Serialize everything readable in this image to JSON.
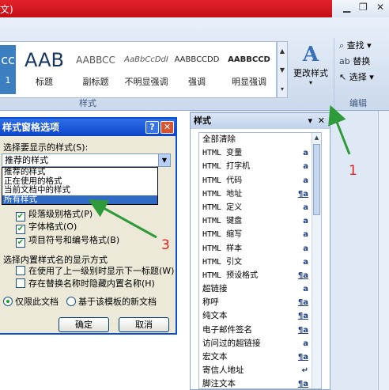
{
  "window": {
    "title_fragment": "文)"
  },
  "gallery": {
    "items": [
      {
        "preview": "cc",
        "name": "1"
      },
      {
        "preview": "AAB",
        "name": "标题"
      },
      {
        "preview": "AABBCC",
        "name": "副标题"
      },
      {
        "preview": "AaBbCcDdI",
        "name": "不明显强调"
      },
      {
        "preview": "AABBCCDD",
        "name": "强调"
      },
      {
        "preview": "AABBCCD",
        "name": "明显强调"
      }
    ]
  },
  "change_styles": {
    "label": "更改样式"
  },
  "group_labels": {
    "styles": "样式",
    "editing": "编辑"
  },
  "editing": {
    "find": "查找",
    "replace": "替换",
    "select": "选择"
  },
  "styles_pane": {
    "title": "样式",
    "items": [
      {
        "name": "全部清除",
        "icon": ""
      },
      {
        "name": "HTML 变量",
        "icon": "a"
      },
      {
        "name": "HTML 打字机",
        "icon": "a"
      },
      {
        "name": "HTML 代码",
        "icon": "a"
      },
      {
        "name": "HTML 地址",
        "icon": "¶a"
      },
      {
        "name": "HTML 定义",
        "icon": "a"
      },
      {
        "name": "HTML 键盘",
        "icon": "a"
      },
      {
        "name": "HTML 缩写",
        "icon": "a"
      },
      {
        "name": "HTML 样本",
        "icon": "a"
      },
      {
        "name": "HTML 引文",
        "icon": "a"
      },
      {
        "name": "HTML 预设格式",
        "icon": "¶a"
      },
      {
        "name": "超链接",
        "icon": "a"
      },
      {
        "name": "称呼",
        "icon": "¶a"
      },
      {
        "name": "纯文本",
        "icon": "¶a"
      },
      {
        "name": "电子邮件签名",
        "icon": "¶a"
      },
      {
        "name": "访问过的超链接",
        "icon": "a"
      },
      {
        "name": "宏文本",
        "icon": "¶a"
      },
      {
        "name": "寄信人地址",
        "icon": "↵"
      },
      {
        "name": "脚注文本",
        "icon": "¶a"
      }
    ]
  },
  "dialog": {
    "title": "样式窗格选项",
    "select_label": "选择要显示的样式(S):",
    "combo_value": "推荐的样式",
    "options": [
      "推荐的样式",
      "正在使用的格式",
      "当前文档中的样式",
      "所有样式"
    ],
    "highlighted_option": "所有样式",
    "checkboxes": [
      {
        "label": "段落级别格式(P)",
        "checked": true
      },
      {
        "label": "字体格式(O)",
        "checked": true
      },
      {
        "label": "项目符号和编号格式(B)",
        "checked": true
      }
    ],
    "builtin_label": "选择内置样式名的显示方式",
    "builtin_checkboxes": [
      {
        "label": "在使用了上一级别时显示下一标题(W)",
        "checked": false
      },
      {
        "label": "存在替换名称时隐藏内置名称(H)",
        "checked": false
      }
    ],
    "radios": [
      {
        "label": "仅限此文档",
        "checked": true
      },
      {
        "label": "基于该模板的新文档",
        "checked": false
      }
    ],
    "ok": "确定",
    "cancel": "取消",
    "help": "?",
    "close": "✕"
  },
  "annotations": [
    "1",
    "3"
  ],
  "colors": {
    "accent": "#3c7fc1",
    "title_red": "#d51920",
    "annotation_arrow": "#2f9a3a",
    "annotation_number": "#e02020"
  }
}
